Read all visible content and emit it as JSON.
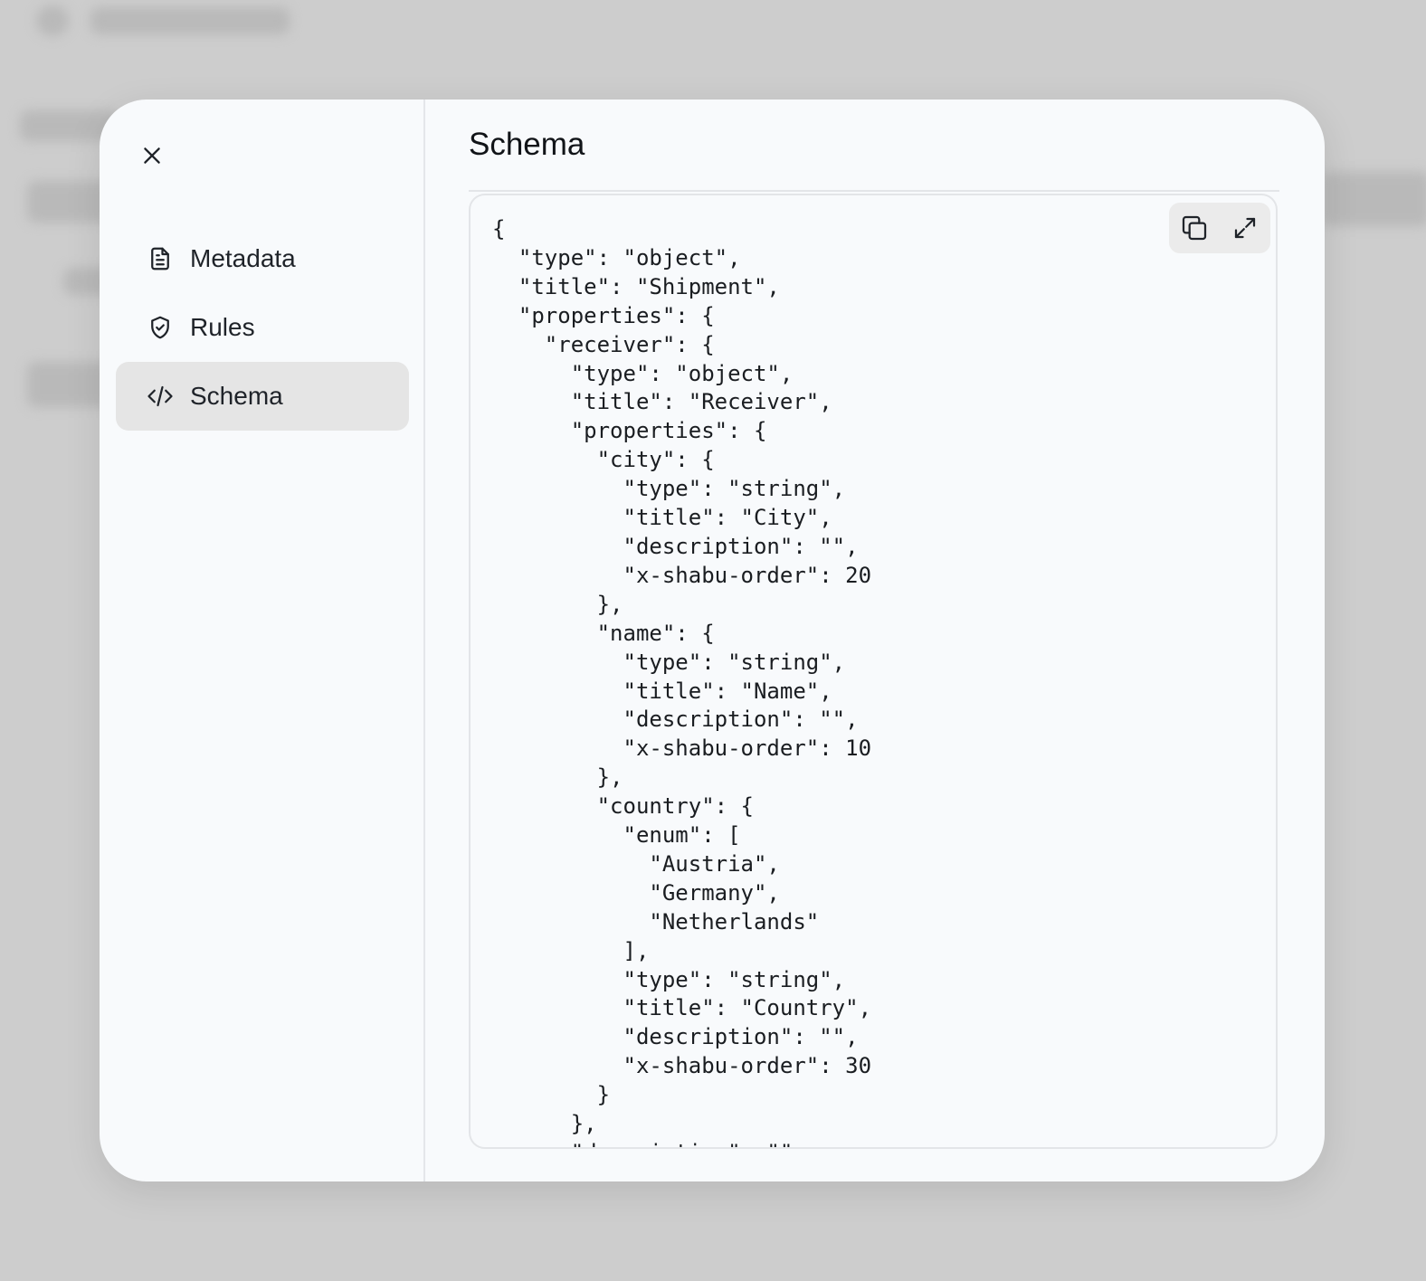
{
  "sidebar": {
    "items": [
      {
        "label": "Metadata",
        "icon": "file-text-icon"
      },
      {
        "label": "Rules",
        "icon": "shield-check-icon"
      },
      {
        "label": "Schema",
        "icon": "code-icon",
        "active": true
      }
    ]
  },
  "main": {
    "title": "Schema",
    "code": "{\n  \"type\": \"object\",\n  \"title\": \"Shipment\",\n  \"properties\": {\n    \"receiver\": {\n      \"type\": \"object\",\n      \"title\": \"Receiver\",\n      \"properties\": {\n        \"city\": {\n          \"type\": \"string\",\n          \"title\": \"City\",\n          \"description\": \"\",\n          \"x-shabu-order\": 20\n        },\n        \"name\": {\n          \"type\": \"string\",\n          \"title\": \"Name\",\n          \"description\": \"\",\n          \"x-shabu-order\": 10\n        },\n        \"country\": {\n          \"enum\": [\n            \"Austria\",\n            \"Germany\",\n            \"Netherlands\"\n          ],\n          \"type\": \"string\",\n          \"title\": \"Country\",\n          \"description\": \"\",\n          \"x-shabu-order\": 30\n        }\n      },\n      \"description\": \"\""
  },
  "toolbar": {
    "copy_icon": "copy-icon",
    "expand_icon": "expand-icon"
  }
}
